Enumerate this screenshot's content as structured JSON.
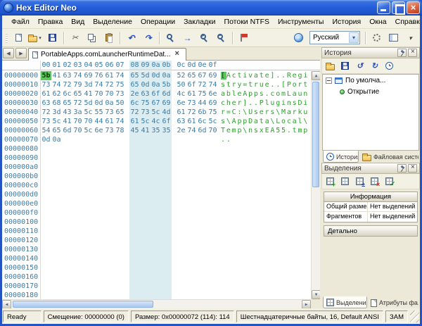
{
  "window": {
    "title": "Hex Editor Neo"
  },
  "menu": {
    "items": [
      "Файл",
      "Правка",
      "Вид",
      "Выделение",
      "Операции",
      "Закладки",
      "Потоки NTFS",
      "Инструменты",
      "История",
      "Окна",
      "Справка"
    ]
  },
  "toolbar": {
    "language_select": "Русский",
    "main_icons": [
      {
        "name": "new-file"
      },
      {
        "name": "open-file",
        "dropdown": true
      },
      {
        "name": "save-file"
      },
      {
        "sep": true
      },
      {
        "name": "cut"
      },
      {
        "name": "copy"
      },
      {
        "name": "paste"
      },
      {
        "sep": true
      },
      {
        "name": "undo"
      },
      {
        "name": "redo"
      },
      {
        "sep": true
      },
      {
        "name": "find"
      },
      {
        "name": "goto"
      },
      {
        "name": "zoom-in"
      },
      {
        "name": "zoom-out"
      },
      {
        "sep": true
      },
      {
        "name": "bookmark"
      }
    ],
    "right_icons": [
      {
        "name": "settings"
      },
      {
        "name": "panels"
      },
      {
        "name": "chevron-down"
      }
    ]
  },
  "tabbar": {
    "document_tab": "PortableApps.comLauncherRuntimeDat..."
  },
  "hex": {
    "col_headers": [
      "00",
      "01",
      "02",
      "03",
      "04",
      "05",
      "06",
      "07",
      "08",
      "09",
      "0a",
      "0b",
      "0c",
      "0d",
      "0e",
      "0f"
    ],
    "selection": {
      "row": 0,
      "col": 0
    },
    "rows": [
      {
        "addr": "00000000",
        "bytes": [
          "5b",
          "41",
          "63",
          "74",
          "69",
          "76",
          "61",
          "74",
          "65",
          "5d",
          "0d",
          "0a",
          "52",
          "65",
          "67",
          "69"
        ],
        "text": "[Activate]..Regi"
      },
      {
        "addr": "00000010",
        "bytes": [
          "73",
          "74",
          "72",
          "79",
          "3d",
          "74",
          "72",
          "75",
          "65",
          "0d",
          "0a",
          "5b",
          "50",
          "6f",
          "72",
          "74"
        ],
        "text": "stry=true..[Port"
      },
      {
        "addr": "00000020",
        "bytes": [
          "61",
          "62",
          "6c",
          "65",
          "41",
          "70",
          "70",
          "73",
          "2e",
          "63",
          "6f",
          "6d",
          "4c",
          "61",
          "75",
          "6e"
        ],
        "text": "ableApps.comLaun"
      },
      {
        "addr": "00000030",
        "bytes": [
          "63",
          "68",
          "65",
          "72",
          "5d",
          "0d",
          "0a",
          "50",
          "6c",
          "75",
          "67",
          "69",
          "6e",
          "73",
          "44",
          "69"
        ],
        "text": "cher]..PluginsDi"
      },
      {
        "addr": "00000040",
        "bytes": [
          "72",
          "3d",
          "43",
          "3a",
          "5c",
          "55",
          "73",
          "65",
          "72",
          "73",
          "5c",
          "4d",
          "61",
          "72",
          "6b",
          "75"
        ],
        "text": "r=C:\\Users\\Marku"
      },
      {
        "addr": "00000050",
        "bytes": [
          "73",
          "5c",
          "41",
          "70",
          "70",
          "44",
          "61",
          "74",
          "61",
          "5c",
          "4c",
          "6f",
          "63",
          "61",
          "6c",
          "5c"
        ],
        "text": "s\\AppData\\Local\\"
      },
      {
        "addr": "00000060",
        "bytes": [
          "54",
          "65",
          "6d",
          "70",
          "5c",
          "6e",
          "73",
          "78",
          "45",
          "41",
          "35",
          "35",
          "2e",
          "74",
          "6d",
          "70"
        ],
        "text": "Temp\\nsxEA55.tmp"
      },
      {
        "addr": "00000070",
        "bytes": [
          "0d",
          "0a"
        ],
        "text": ".."
      },
      {
        "addr": "00000080",
        "bytes": [],
        "text": ""
      },
      {
        "addr": "00000090",
        "bytes": [],
        "text": ""
      },
      {
        "addr": "000000a0",
        "bytes": [],
        "text": ""
      },
      {
        "addr": "000000b0",
        "bytes": [],
        "text": ""
      },
      {
        "addr": "000000c0",
        "bytes": [],
        "text": ""
      },
      {
        "addr": "000000d0",
        "bytes": [],
        "text": ""
      },
      {
        "addr": "000000e0",
        "bytes": [],
        "text": ""
      },
      {
        "addr": "000000f0",
        "bytes": [],
        "text": ""
      },
      {
        "addr": "00000100",
        "bytes": [],
        "text": ""
      },
      {
        "addr": "00000110",
        "bytes": [],
        "text": ""
      },
      {
        "addr": "00000120",
        "bytes": [],
        "text": ""
      },
      {
        "addr": "00000130",
        "bytes": [],
        "text": ""
      },
      {
        "addr": "00000140",
        "bytes": [],
        "text": ""
      },
      {
        "addr": "00000150",
        "bytes": [],
        "text": ""
      },
      {
        "addr": "00000160",
        "bytes": [],
        "text": ""
      },
      {
        "addr": "00000170",
        "bytes": [],
        "text": ""
      },
      {
        "addr": "00000180",
        "bytes": [],
        "text": ""
      }
    ]
  },
  "history_panel": {
    "title": "История",
    "tools": [
      {
        "name": "open-history"
      },
      {
        "name": "save-history"
      },
      {
        "name": "undo-history"
      },
      {
        "name": "redo-history"
      },
      {
        "name": "history-settings"
      }
    ],
    "tree_root": "По умолча...",
    "tree_child": "Открытие",
    "tabs": [
      {
        "label": "История",
        "icon": "clock",
        "active": true
      },
      {
        "label": "Файловая систе...",
        "icon": "folder",
        "active": false
      }
    ]
  },
  "selection_panel": {
    "title": "Выделения",
    "tools": [
      {
        "name": "new-selection"
      },
      {
        "name": "save-selection"
      },
      {
        "name": "invert-selection"
      },
      {
        "name": "clear-selection"
      },
      {
        "name": "edit-selection"
      }
    ],
    "info_title": "Информация",
    "info_rows": [
      {
        "label": "Общий размер",
        "value": "Нет выделений"
      },
      {
        "label": "Фрагментов",
        "value": "Нет выделений"
      }
    ],
    "details_label": "Детально",
    "tabs": [
      {
        "label": "Выделения",
        "icon": "grid",
        "active": true
      },
      {
        "label": "Атрибуты фа...",
        "icon": "attributes",
        "active": false
      }
    ]
  },
  "statusbar": {
    "ready": "Ready",
    "offset": "Смещение: 00000000 (0)",
    "size": "Размер: 0x00000072 (114): 114",
    "encoding": "Шестнадцатеричные байты, 16, Default ANSI",
    "mode": "ЗАМ"
  }
}
